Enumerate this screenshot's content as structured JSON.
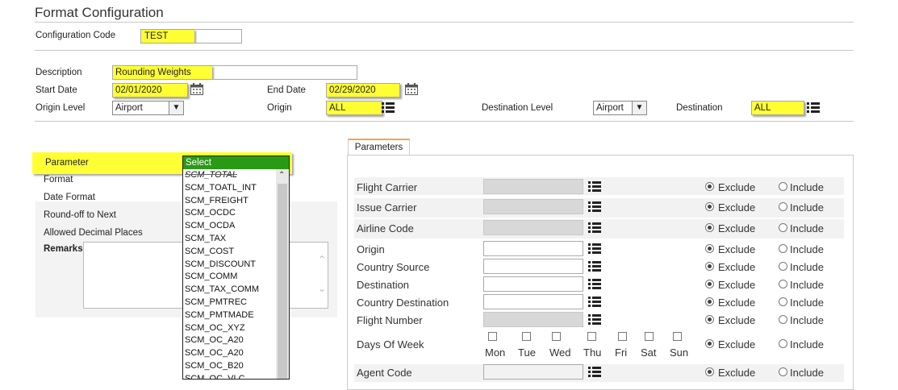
{
  "page": {
    "title": "Format Configuration"
  },
  "config": {
    "code_label": "Configuration Code",
    "code_value": "TEST",
    "description_label": "Description",
    "description_value": "Rounding Weights",
    "start_date_label": "Start Date",
    "start_date_value": "02/01/2020",
    "end_date_label": "End Date",
    "end_date_value": "02/29/2020",
    "origin_level_label": "Origin Level",
    "origin_level_value": "Airport",
    "origin_label": "Origin",
    "origin_value": "ALL",
    "destination_level_label": "Destination Level",
    "destination_level_value": "Airport",
    "destination_label": "Destination",
    "destination_value": "ALL"
  },
  "left_form": {
    "parameter_label": "Parameter",
    "format_label": "Format",
    "date_format_label": "Date Format",
    "round_off_label": "Round-off to Next",
    "decimal_label": "Allowed Decimal Places",
    "remarks_label": "Remarks"
  },
  "parameter_dropdown": {
    "selected": "Select",
    "options": [
      "SCM_TOTAL",
      "SCM_TOATL_INT",
      "SCM_FREIGHT",
      "SCM_OCDC",
      "SCM_OCDA",
      "SCM_TAX",
      "SCM_COST",
      "SCM_DISCOUNT",
      "SCM_COMM",
      "SCM_TAX_COMM",
      "SCM_PMTREC",
      "SCM_PMTMADE",
      "SCM_OC_XYZ",
      "SCM_OC_A20",
      "SCM_OC_A20",
      "SCM_OC_B20",
      "SCM_OC_VLC"
    ]
  },
  "parameters_tab": {
    "tab_label": "Parameters",
    "exclude_label": "Exclude",
    "include_label": "Include",
    "rows": [
      {
        "label": "Flight Carrier"
      },
      {
        "label": "Issue Carrier"
      },
      {
        "label": "Airline Code"
      },
      {
        "label": "Origin"
      },
      {
        "label": "Country Source"
      },
      {
        "label": "Destination"
      },
      {
        "label": "Country Destination"
      },
      {
        "label": "Flight Number"
      },
      {
        "label": "Days Of Week"
      },
      {
        "label": "Agent Code"
      }
    ],
    "days": [
      "Mon",
      "Tue",
      "Wed",
      "Thu",
      "Fri",
      "Sat",
      "Sun"
    ]
  }
}
